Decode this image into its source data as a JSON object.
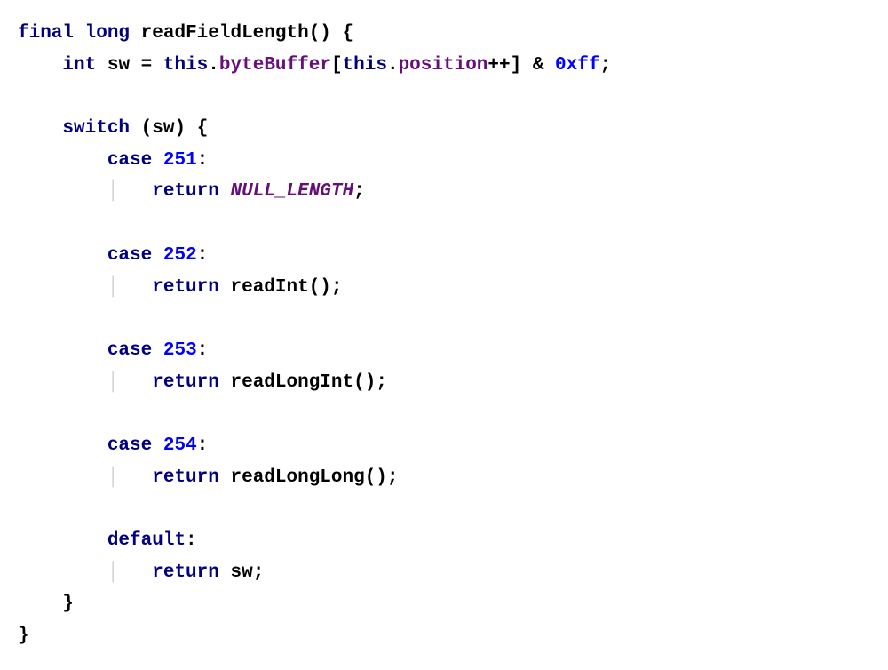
{
  "code": {
    "kw_final": "final",
    "kw_long": "long",
    "method_name": "readFieldLength",
    "paren_open": "(",
    "paren_close": ")",
    "space": " ",
    "brace_open": "{",
    "brace_close": "}",
    "kw_int": "int",
    "var_sw": "sw",
    "assign": " = ",
    "kw_this1": "this",
    "dot": ".",
    "field_byteBuffer": "byteBuffer",
    "bracket_open": "[",
    "kw_this2": "this",
    "field_position": "position",
    "inc": "++",
    "bracket_close": "]",
    "amp": " & ",
    "hex_ff": "0xff",
    "semi": ";",
    "kw_switch": "switch",
    "paren_sw_open": " (",
    "paren_sw_close": ") ",
    "kw_case1": "case",
    "num_251": "251",
    "colon": ":",
    "kw_return1": "return",
    "const_null_length": "NULL_LENGTH",
    "kw_case2": "case",
    "num_252": "252",
    "kw_return2": "return",
    "call_readInt": "readInt()",
    "kw_case3": "case",
    "num_253": "253",
    "kw_return3": "return",
    "call_readLongInt": "readLongInt()",
    "kw_case4": "case",
    "num_254": "254",
    "kw_return4": "return",
    "call_readLongLong": "readLongLong()",
    "kw_default": "default",
    "kw_return5": "return",
    "var_sw_ret": "sw"
  }
}
